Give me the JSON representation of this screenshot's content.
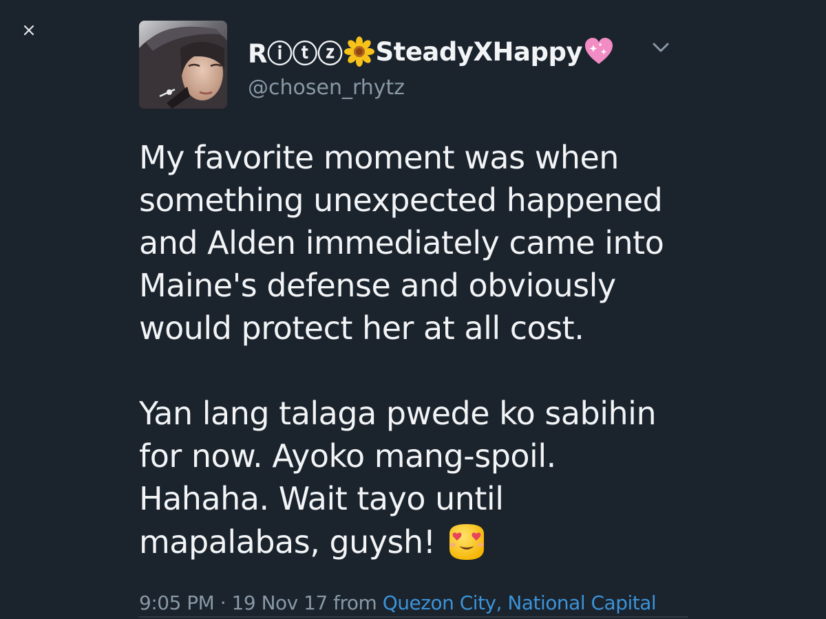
{
  "close": {
    "icon": "close-icon"
  },
  "tweet": {
    "avatar_icon": "user-avatar",
    "display_name_prefix": "Rⓘⓣⓩ",
    "display_name_emoji": "sunflower-icon",
    "display_name_main": "SteadyXHappy",
    "display_name_suffix_emoji": "sparkling-heart-icon",
    "handle": "@chosen_rhytz",
    "menu_icon": "chevron-down-icon",
    "paragraph_1": [
      "My favorite moment was when",
      "something unexpected happened",
      "and Alden immediately came into",
      "Maine's defense and obviously",
      "would protect her at all cost."
    ],
    "paragraph_2": [
      "Yan lang talaga pwede ko sabihin",
      "for now.  Ayoko mang-spoil.",
      "Hahaha.  Wait tayo until",
      "mapalabas, guysh!"
    ],
    "end_emoji": "heart-eyes-emoji",
    "time": "9:05 PM",
    "separator": "·",
    "date": "19 Nov 17",
    "from_label": "from",
    "location": "Quezon City, National Capital"
  },
  "colors": {
    "background": "#1b232d",
    "text": "#f2f4f6",
    "secondary_text": "#8899a6",
    "link": "#3b94d9"
  }
}
